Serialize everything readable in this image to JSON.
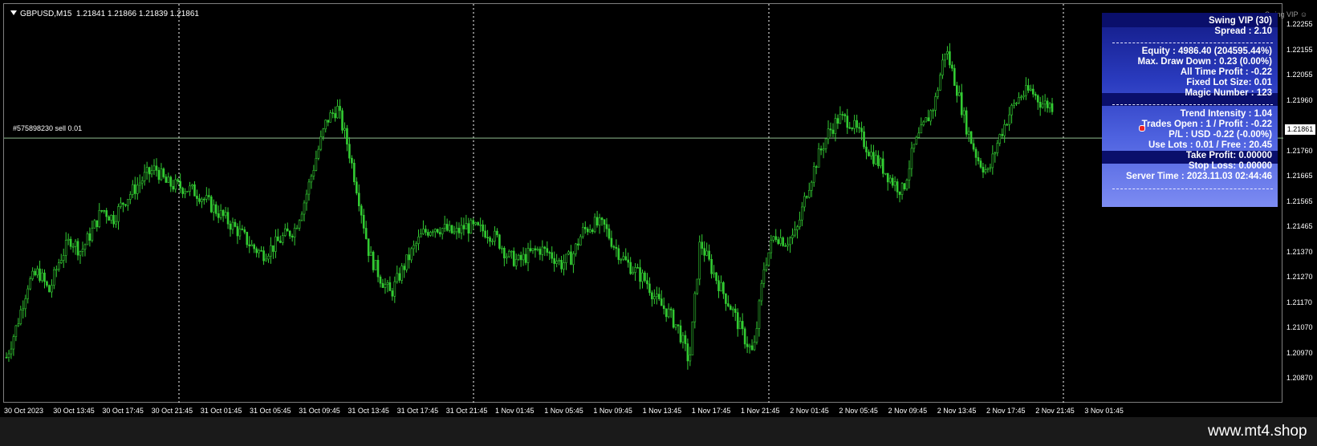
{
  "chart_header": {
    "symbol_timeframe": "GBPUSD,M15",
    "ohlc": "1.21841 1.21866 1.21839 1.21861"
  },
  "ea_name": "Swing VIP ☺",
  "order_line_label": "#575898230 sell 0.01",
  "current_price": "1.21861",
  "price_axis": [
    "1.22255",
    "1.22155",
    "1.22055",
    "1.21960",
    "1.21861",
    "1.21760",
    "1.21665",
    "1.21565",
    "1.21465",
    "1.21370",
    "1.21270",
    "1.21170",
    "1.21070",
    "1.20970",
    "1.20870"
  ],
  "time_axis": [
    "30 Oct 2023",
    "30 Oct 13:45",
    "30 Oct 17:45",
    "30 Oct 21:45",
    "31 Oct 01:45",
    "31 Oct 05:45",
    "31 Oct 09:45",
    "31 Oct 13:45",
    "31 Oct 17:45",
    "31 Oct 21:45",
    "1 Nov 01:45",
    "1 Nov 05:45",
    "1 Nov 09:45",
    "1 Nov 13:45",
    "1 Nov 17:45",
    "1 Nov 21:45",
    "2 Nov 01:45",
    "2 Nov 05:45",
    "2 Nov 09:45",
    "2 Nov 13:45",
    "2 Nov 17:45",
    "2 Nov 21:45",
    "3 Nov 01:45"
  ],
  "info_panel": {
    "title": "Swing VIP (30)",
    "spread": "Spread : 2.10",
    "equity": "Equity : 4986.40 (204595.44%)",
    "max_drawdown": "Max. Draw Down : 0.23 (0.00%)",
    "all_time_profit": "All Time Profit : -0.22",
    "fixed_lot": "Fixed Lot Size: 0.01",
    "magic": "Magic Number : 123",
    "trend": "Trend Intensity : 1.04",
    "trades_open": "Trades Open : 1 / Profit : -0.22",
    "pl": "P/L : USD -0.22 (-0.00%)",
    "use_lots": "Use Lots : 0.01 / Free : 20.45",
    "take_profit": "Take Profit: 0.00000",
    "stop_loss": "Stop Loss: 0.00000",
    "server_time": "Server Time : 2023.11.03 02:44:46"
  },
  "watermark": "www.mt4.shop",
  "colors": {
    "candle": "#33cc33",
    "background": "#000000",
    "grid": "#ffffff",
    "order_line": "#8fbc8f"
  },
  "chart_data": {
    "type": "line",
    "title": "GBPUSD,M15",
    "close_values": [
      1.2099,
      1.2112,
      1.2128,
      1.2133,
      1.2125,
      1.2138,
      1.2146,
      1.2141,
      1.2149,
      1.2158,
      1.2154,
      1.2161,
      1.2166,
      1.2171,
      1.2174,
      1.2168,
      1.2167,
      1.2166,
      1.2164,
      1.216,
      1.2156,
      1.2152,
      1.2148,
      1.2143,
      1.214,
      1.2143,
      1.2147,
      1.215,
      1.2162,
      1.2178,
      1.2193,
      1.2198,
      1.2183,
      1.2163,
      1.214,
      1.2131,
      1.2124,
      1.2133,
      1.2141,
      1.2148,
      1.2151,
      1.215,
      1.2148,
      1.2151,
      1.215,
      1.2149,
      1.2146,
      1.2139,
      1.2137,
      1.214,
      1.2142,
      1.214,
      1.2136,
      1.2139,
      1.2149,
      1.2152,
      1.2151,
      1.2143,
      1.2137,
      1.2133,
      1.2129,
      1.2121,
      1.2117,
      1.211,
      1.2097,
      1.2145,
      1.2135,
      1.2126,
      1.2118,
      1.2108,
      1.21,
      1.2135,
      1.2148,
      1.2145,
      1.2148,
      1.2165,
      1.2178,
      1.2188,
      1.2194,
      1.2193,
      1.2187,
      1.218,
      1.2175,
      1.2169,
      1.2165,
      1.2182,
      1.2191,
      1.22,
      1.2222,
      1.2207,
      1.219,
      1.2178,
      1.2172,
      1.2186,
      1.2196,
      1.2203,
      1.2205,
      1.22,
      1.2199
    ],
    "ylim": [
      1.2087,
      1.2233
    ],
    "order_price": 1.21861,
    "grid": "vertical dotted"
  }
}
